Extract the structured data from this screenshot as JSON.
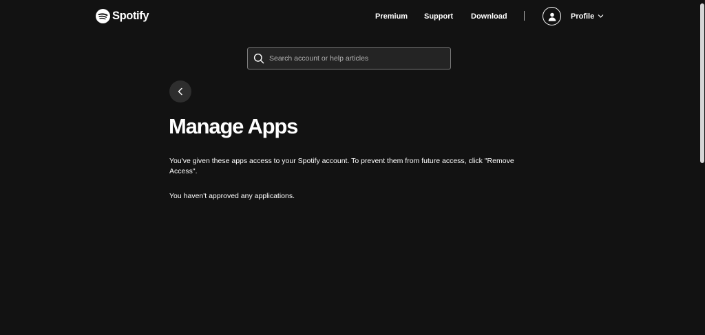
{
  "header": {
    "brand": "Spotify",
    "nav": {
      "premium": "Premium",
      "support": "Support",
      "download": "Download"
    },
    "profile_label": "Profile"
  },
  "search": {
    "placeholder": "Search account or help articles",
    "value": ""
  },
  "page": {
    "title": "Manage Apps",
    "description": "You've given these apps access to your Spotify account. To prevent them from future access, click \"Remove Access\".",
    "empty_message": "You haven't approved any applications."
  },
  "colors": {
    "background": "#121212",
    "text": "#ffffff",
    "search_border": "#7c7c7c",
    "back_button": "#2e2e2e"
  }
}
